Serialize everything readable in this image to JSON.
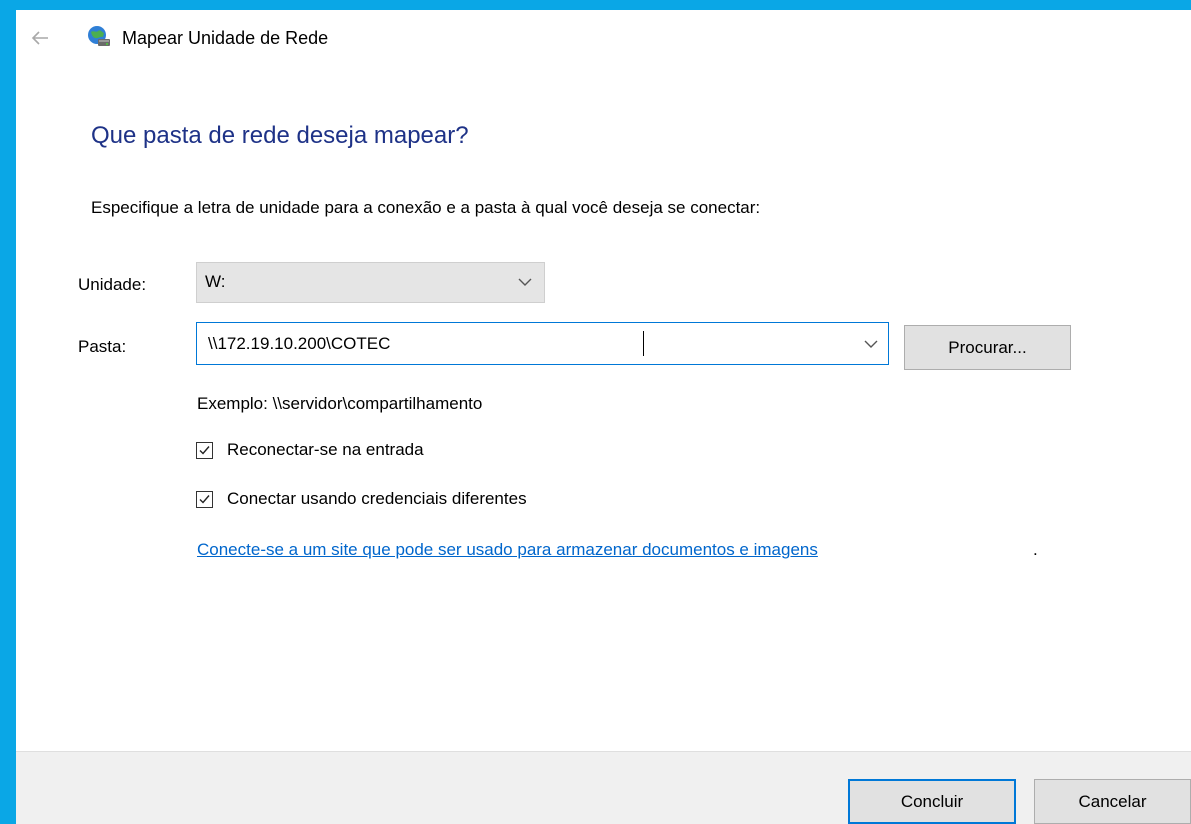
{
  "window": {
    "title": "Mapear Unidade de Rede",
    "back_icon": "arrow-left-icon",
    "app_icon": "network-drive-icon"
  },
  "main_instruction": "Que pasta de rede deseja mapear?",
  "description": "Especifique a letra de unidade para a conexão e a pasta à qual você deseja se conectar:",
  "drive": {
    "label": "Unidade:",
    "selected": "W:"
  },
  "folder": {
    "label": "Pasta:",
    "value": "\\\\172.19.10.200\\COTEC",
    "browse_label": "Procurar..."
  },
  "example": "Exemplo: \\\\servidor\\compartilhamento",
  "options": {
    "reconnect": {
      "label": "Reconectar-se na entrada",
      "checked": true
    },
    "credentials": {
      "label": "Conectar usando credenciais diferentes",
      "checked": true
    }
  },
  "link": {
    "text": "Conecte-se a um site que pode ser usado para armazenar documentos e imagens",
    "suffix": "."
  },
  "buttons": {
    "finish": "Concluir",
    "cancel": "Cancelar"
  },
  "colors": {
    "desktop_accent": "#0aa7e6",
    "instruction_blue": "#1e3287",
    "link_blue": "#0066cc",
    "focus_blue": "#0078d7"
  }
}
